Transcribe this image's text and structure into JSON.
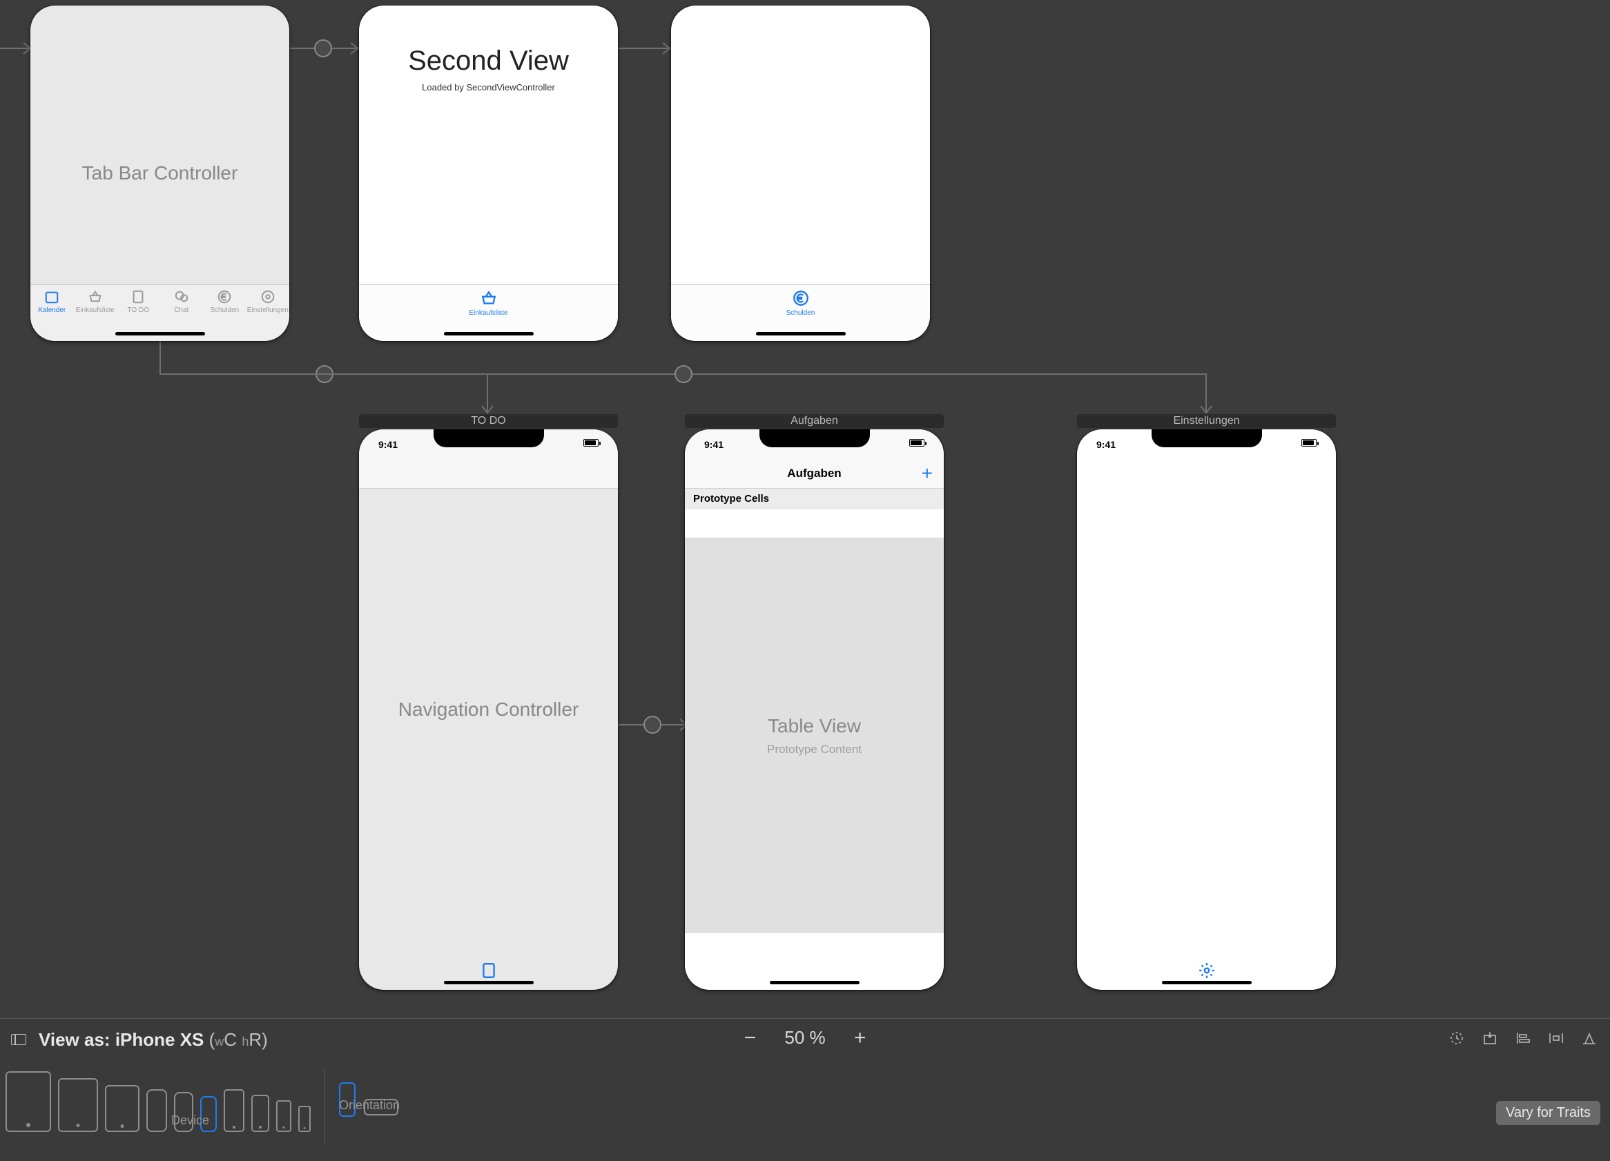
{
  "scenes": {
    "tabbar": {
      "title": "Tab Bar Controller",
      "tabs": [
        "Kalender",
        "Einkaufsliste",
        "TO DO",
        "Chat",
        "Schulden",
        "Einstellungen"
      ]
    },
    "second_view": {
      "title": "Second View",
      "subtitle": "Loaded by SecondViewController",
      "tab": "Einkaufsliste"
    },
    "schulden_view": {
      "tab": "Schulden"
    },
    "nav": {
      "label": "TO DO",
      "title": "Navigation Controller",
      "time": "9:41"
    },
    "aufgaben": {
      "label": "Aufgaben",
      "nav_title": "Aufgaben",
      "proto_header": "Prototype Cells",
      "tv_title": "Table View",
      "tv_sub": "Prototype Content",
      "time": "9:41"
    },
    "einstellungen": {
      "label": "Einstellungen",
      "time": "9:41"
    }
  },
  "bottom": {
    "view_as_prefix": "View as: ",
    "device_name": "iPhone XS",
    "size_w_small": "w",
    "size_w": "C",
    "size_h_small": "h",
    "size_h": "R",
    "zoom": "50 %",
    "device_label": "Device",
    "orientation_label": "Orientation",
    "vary": "Vary for Traits"
  }
}
